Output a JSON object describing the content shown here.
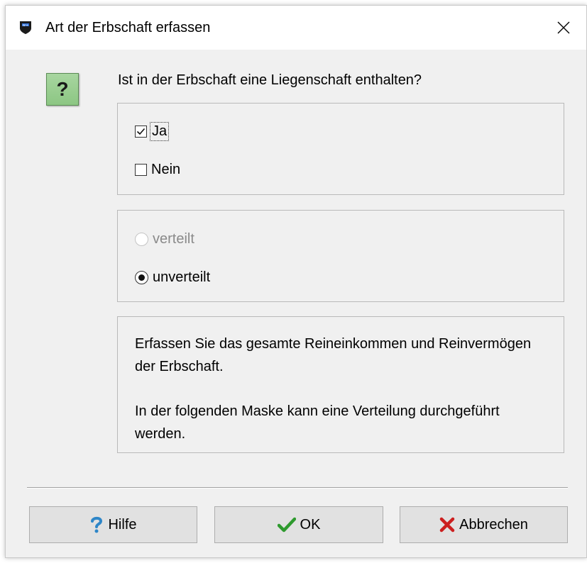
{
  "window": {
    "title": "Art der Erbschaft erfassen",
    "app_icon": "app-logo-icon",
    "close_icon": "close-icon"
  },
  "prompt": {
    "icon": "question-icon",
    "icon_glyph": "?",
    "text": "Ist in der Erbschaft eine Liegenschaft enthalten?"
  },
  "options_group": {
    "items": [
      {
        "label": "Ja",
        "checked": true
      },
      {
        "label": "Nein",
        "checked": false
      }
    ]
  },
  "distribution_group": {
    "items": [
      {
        "label": "verteilt",
        "selected": false,
        "disabled": true
      },
      {
        "label": "unverteilt",
        "selected": true,
        "disabled": false
      }
    ]
  },
  "info": {
    "paragraph1": "Erfassen Sie das gesamte Reineinkommen und Reinvermögen der Erbschaft.",
    "paragraph2": "In der folgenden Maske kann eine Verteilung durchgeführt werden."
  },
  "buttons": {
    "help": {
      "label": "Hilfe",
      "icon": "help-question-icon"
    },
    "ok": {
      "label": "OK",
      "icon": "checkmark-icon"
    },
    "cancel": {
      "label": "Abbrechen",
      "icon": "x-cancel-icon"
    }
  },
  "colors": {
    "dialog_bg": "#f0f0f0",
    "help_icon": "#2e86c8",
    "ok_icon": "#2e9a2e",
    "cancel_icon": "#cc1f1f",
    "question_bg": "#a8d6a0"
  }
}
